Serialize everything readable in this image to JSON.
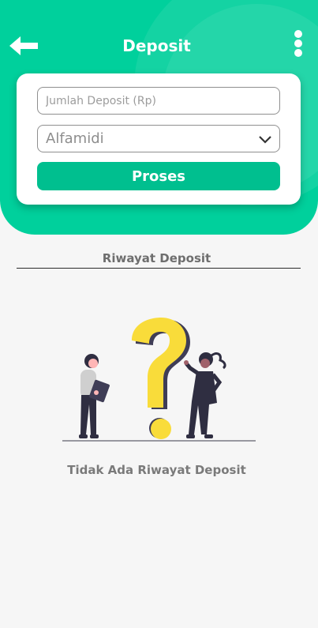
{
  "header": {
    "title": "Deposit",
    "back_icon": "arrow-left-icon",
    "menu_icon": "more-vertical-icon"
  },
  "form": {
    "amount_placeholder": "Jumlah Deposit (Rp)",
    "amount_value": "",
    "store_selected": "Alfamidi",
    "submit_label": "Proses"
  },
  "history": {
    "title": "Riwayat Deposit",
    "empty_text": "Tidak Ada Riwayat Deposit",
    "illustration": "question-mark-people-illustration"
  },
  "colors": {
    "primary": "#00d09c",
    "button": "#00bf8f",
    "illustration_accent": "#f9dc3a",
    "background": "#f6f6f6"
  }
}
